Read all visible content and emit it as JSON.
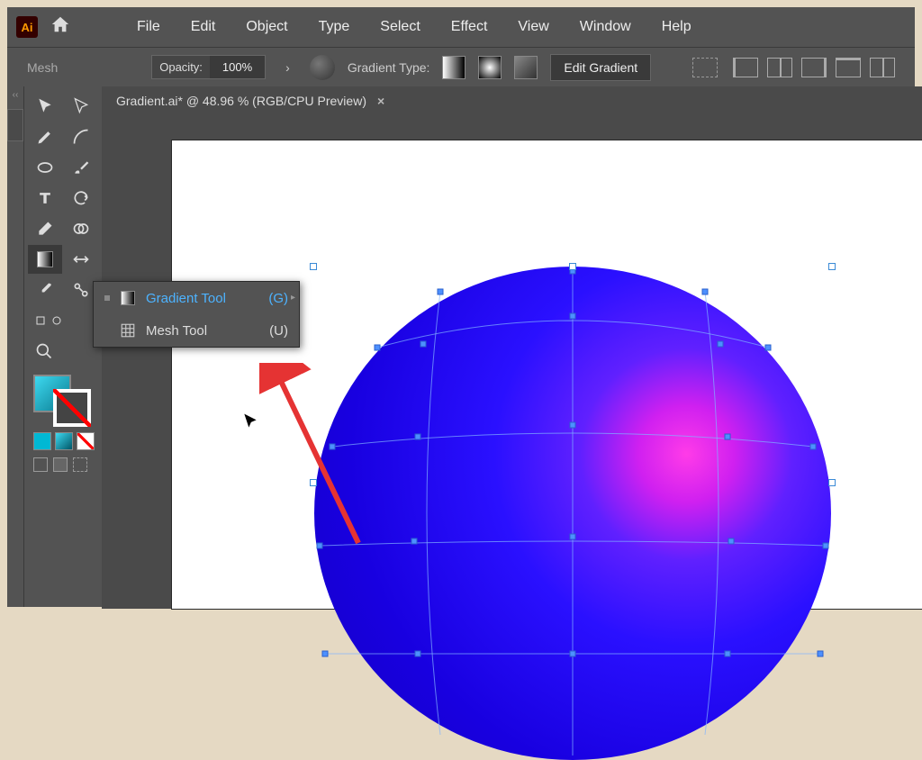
{
  "menu": {
    "items": [
      "File",
      "Edit",
      "Object",
      "Type",
      "Select",
      "Effect",
      "View",
      "Window",
      "Help"
    ]
  },
  "controlBar": {
    "modeLabel": "Mesh",
    "opacityLabel": "Opacity:",
    "opacityValue": "100%",
    "gradientTypeLabel": "Gradient Type:",
    "editGradientLabel": "Edit Gradient"
  },
  "document": {
    "tabTitle": "Gradient.ai* @ 48.96 % (RGB/CPU Preview)"
  },
  "flyout": {
    "items": [
      {
        "label": "Gradient Tool",
        "shortcut": "(G)",
        "active": true
      },
      {
        "label": "Mesh Tool",
        "shortcut": "(U)",
        "active": false
      }
    ]
  },
  "logo": "Ai"
}
